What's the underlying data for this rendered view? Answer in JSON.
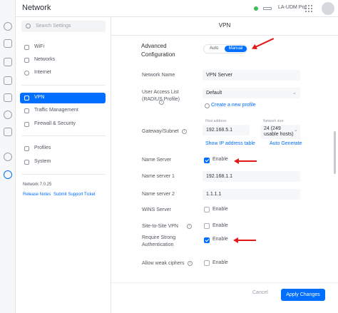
{
  "app": {
    "title": "Network"
  },
  "topbar": {
    "device_name": "LA-UDM Pro",
    "device_chevron": "⌄",
    "status_color": "#3dbd5a"
  },
  "sidebar": {
    "search_placeholder": "Search Settings",
    "items": [
      {
        "label": "WiFi",
        "icon": "wifi-icon"
      },
      {
        "label": "Networks",
        "icon": "networks-icon"
      },
      {
        "label": "Internet",
        "icon": "internet-icon"
      },
      {
        "label": "VPN",
        "icon": "vpn-icon",
        "active": true
      },
      {
        "label": "Traffic Management",
        "icon": "traffic-icon"
      },
      {
        "label": "Firewall & Security",
        "icon": "firewall-icon"
      },
      {
        "label": "Profiles",
        "icon": "profiles-icon"
      },
      {
        "label": "System",
        "icon": "system-icon"
      }
    ],
    "version": "Network 7.0.25",
    "links": [
      "Release Notes",
      "Submit Support Ticket"
    ]
  },
  "panel": {
    "title": "VPN",
    "advanced_label": "Advanced Configuration",
    "advanced_options": [
      "Auto",
      "Manual"
    ],
    "advanced_selected": "Manual",
    "network_name_label": "Network Name",
    "network_name_value": "VPN Server",
    "user_access_label": "User Access List (RADIUS Profile)",
    "user_access_value": "Default",
    "create_profile_link": "Create a new profile",
    "gateway_label": "Gateway/Subnet",
    "host_address_label": "Host address",
    "host_address_value": "192.168.5.1",
    "network_size_label": "Network size",
    "network_size_value": "24 (249 usable hosts)",
    "show_ip_link": "Show IP address table",
    "auto_generate_link": "Auto Generate",
    "name_server_label": "Name Server",
    "name_server_enabled": true,
    "name_server_1_label": "Name server 1",
    "name_server_1_value": "192.168.1.1",
    "name_server_2_label": "Name server 2",
    "name_server_2_value": "1.1.1.1",
    "wins_label": "WINS Server",
    "wins_enabled": false,
    "site_to_site_label": "Site-to-Site VPN",
    "site_to_site_enabled": false,
    "require_auth_label": "Require Strong Authentication",
    "require_auth_enabled": true,
    "weak_ciphers_label": "Allow weak ciphers",
    "weak_ciphers_enabled": false,
    "enable_text": "Enable",
    "info_glyph": "i"
  },
  "footer": {
    "cancel_label": "Cancel",
    "apply_label": "Apply Changes"
  },
  "colors": {
    "accent": "#006fff",
    "annotation_arrow": "#e01818"
  }
}
